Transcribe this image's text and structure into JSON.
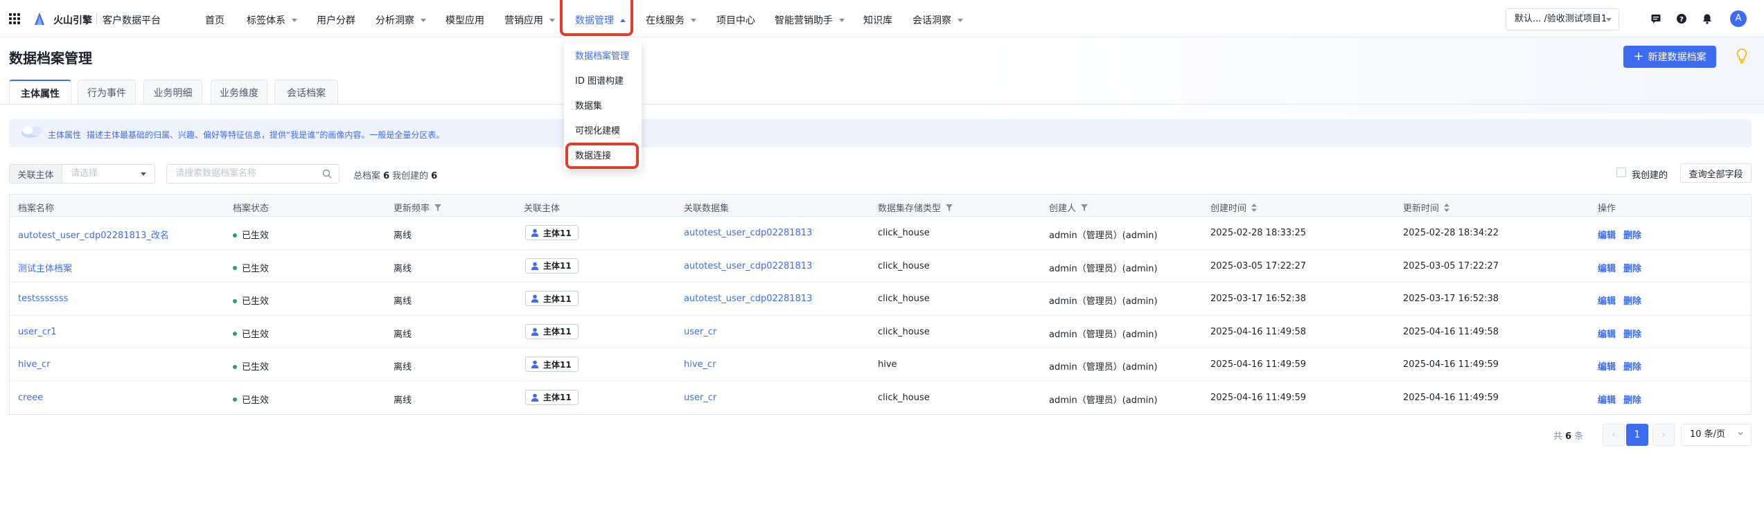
{
  "header": {
    "brand": "火山引擎",
    "platform": "客户数据平台",
    "nav": [
      {
        "label": "首页",
        "caret": false
      },
      {
        "label": "标签体系",
        "caret": true
      },
      {
        "label": "用户分群",
        "caret": false
      },
      {
        "label": "分析洞察",
        "caret": true
      },
      {
        "label": "模型应用",
        "caret": false
      },
      {
        "label": "营销应用",
        "caret": true
      },
      {
        "label": "数据管理",
        "caret": true,
        "active": true
      },
      {
        "label": "在线服务",
        "caret": true
      },
      {
        "label": "项目中心",
        "caret": false
      },
      {
        "label": "智能营销助手",
        "caret": true
      },
      {
        "label": "知识库",
        "caret": false
      },
      {
        "label": "会话洞察",
        "caret": true
      }
    ],
    "project": "默认... /验收测试项目1",
    "avatar": "A"
  },
  "page": {
    "title": "数据档案管理",
    "create_button": "新建数据档案"
  },
  "tabs": [
    {
      "label": "主体属性",
      "active": true
    },
    {
      "label": "行为事件"
    },
    {
      "label": "业务明细"
    },
    {
      "label": "业务维度"
    },
    {
      "label": "会话档案"
    }
  ],
  "banner": {
    "label": "主体属性",
    "text": "描述主体最基础的归属、兴趣、偏好等特征信息，提供“我是谁”的画像内容。一般是全量分区表。"
  },
  "filters": {
    "entity_label": "关联主体",
    "entity_placeholder": "请选择",
    "search_placeholder": "请搜索数据档案名称",
    "total_label": "总档案",
    "total_value": "6",
    "mine_label": "我创建的",
    "mine_value": "6",
    "mine_checkbox_label": "我创建的",
    "query_all_button": "查询全部字段"
  },
  "table": {
    "columns": [
      "档案名称",
      "档案状态",
      "更新频率",
      "关联主体",
      "关联数据集",
      "数据集存储类型",
      "创建人",
      "创建时间",
      "更新时间",
      "操作"
    ],
    "rows": [
      {
        "name": "autotest_user_cdp02281813_改名",
        "status": "已生效",
        "freq": "离线",
        "entity": "主体11",
        "dataset": "autotest_user_cdp02281813",
        "storage": "click_house",
        "creator": "admin（管理员）(admin)",
        "created": "2025-02-28 18:33:25",
        "updated": "2025-02-28 18:34:22"
      },
      {
        "name": "测试主体档案",
        "status": "已生效",
        "freq": "离线",
        "entity": "主体11",
        "dataset": "autotest_user_cdp02281813",
        "storage": "click_house",
        "creator": "admin（管理员）(admin)",
        "created": "2025-03-05 17:22:27",
        "updated": "2025-03-05 17:22:27"
      },
      {
        "name": "testsssssss",
        "status": "已生效",
        "freq": "离线",
        "entity": "主体11",
        "dataset": "autotest_user_cdp02281813",
        "storage": "click_house",
        "creator": "admin（管理员）(admin)",
        "created": "2025-03-17 16:52:38",
        "updated": "2025-03-17 16:52:38"
      },
      {
        "name": "user_cr1",
        "status": "已生效",
        "freq": "离线",
        "entity": "主体11",
        "dataset": "user_cr",
        "storage": "click_house",
        "creator": "admin（管理员）(admin)",
        "created": "2025-04-16 11:49:58",
        "updated": "2025-04-16 11:49:58"
      },
      {
        "name": "hive_cr",
        "status": "已生效",
        "freq": "离线",
        "entity": "主体11",
        "dataset": "hive_cr",
        "storage": "hive",
        "creator": "admin（管理员）(admin)",
        "created": "2025-04-16 11:49:59",
        "updated": "2025-04-16 11:49:59"
      },
      {
        "name": "creee",
        "status": "已生效",
        "freq": "离线",
        "entity": "主体11",
        "dataset": "user_cr",
        "storage": "click_house",
        "creator": "admin（管理员）(admin)",
        "created": "2025-04-16 11:49:59",
        "updated": "2025-04-16 11:49:59"
      }
    ],
    "edit_label": "编辑",
    "delete_label": "删除"
  },
  "pagination": {
    "total_prefix": "共",
    "total_value": "6",
    "total_suffix": "条",
    "prev": "‹",
    "current": "1",
    "next": "›",
    "page_size": "10 条/页"
  },
  "dropdown": {
    "items": [
      {
        "label": "数据档案管理",
        "active": true
      },
      {
        "label": "ID 图谱构建"
      },
      {
        "label": "数据集"
      },
      {
        "label": "可视化建模"
      },
      {
        "label": "数据连接",
        "highlighted": true
      }
    ]
  },
  "colors": {
    "accent": "#3d6cf0",
    "highlight": "#e23d2a",
    "status_ok": "#26a269"
  }
}
